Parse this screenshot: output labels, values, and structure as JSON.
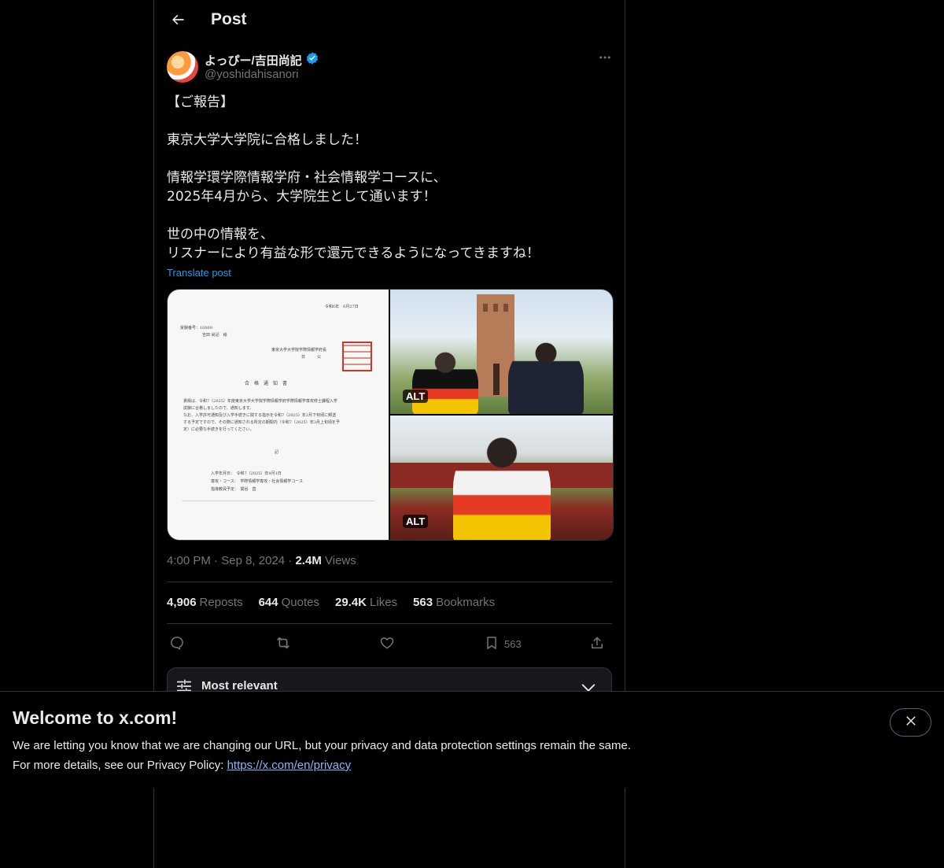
{
  "header": {
    "title": "Post"
  },
  "post": {
    "author_name": "よっぴー/吉田尚記",
    "author_handle": "@yoshidahisanori",
    "text": "【ご報告】\n\n東京大学大学院に合格しました！\n\n情報学環学際情報学府・社会情報学コースに、\n2025年4月から、大学院生として通います！\n\n世の中の情報を、\nリスナーにより有益な形で還元できるようになってきますね！",
    "translate_label": "Translate post",
    "media": {
      "alt_badge_1": "ALT",
      "alt_badge_2": "ALT",
      "document": {
        "date": "令和6年　6月27日",
        "exam_no": "受験番号：10000",
        "recipient": "吉田 尚記　様",
        "sender_1": "東京大学大学院学際情報学府長",
        "sender_2": "日　　　公",
        "heading": "合　格　通　知　書",
        "body_1": "貴殿は、令和7（2025）年度東京大学大学院学際情報学府学際情報学専攻修士課程入学",
        "body_2": "試験に合格しましたので、通知します。",
        "body_3": "なお、入学許可通知及び入学手続きに関する指示を令和7（2025）年2月下旬頃に郵送",
        "body_4": "する予定ですので、その際に通知される所定の期間内（令和7（2025）年3月上旬頃を予",
        "body_5": "定）に必要な手続きを行ってください。",
        "note": "記",
        "enroll": "入学年月日：　令和7（2025）年4月1日",
        "course": "専攻・コース：　学際情報学専攻・社会情報学コース",
        "advisor": "指導教員予定：　関谷　直"
      }
    },
    "time": "4:00 PM",
    "date": "Sep 8, 2024",
    "views_count": "2.4M",
    "views_label": "Views",
    "stats": {
      "reposts_count": "4,906",
      "reposts_label": "Reposts",
      "quotes_count": "644",
      "quotes_label": "Quotes",
      "likes_count": "29.4K",
      "likes_label": "Likes",
      "bookmarks_count": "563",
      "bookmarks_label": "Bookmarks"
    },
    "actions": {
      "bookmark_count": "563"
    }
  },
  "replies": {
    "sort_label": "Most relevant"
  },
  "banner": {
    "title": "Welcome to x.com!",
    "line1": "We are letting you know that we are changing our URL, but your privacy and data protection settings remain the same.",
    "line2_prefix": "For more details, see our Privacy Policy: ",
    "link_text": "https://x.com/en/privacy"
  },
  "icons": {
    "back": "back-arrow-icon",
    "verified": "verified-badge-icon",
    "more": "more-icon",
    "reply": "reply-icon",
    "repost": "repost-icon",
    "like": "heart-icon",
    "bookmark": "bookmark-icon",
    "share": "share-icon",
    "sort": "sliders-icon",
    "chevron": "chevron-down-icon",
    "close": "close-icon"
  },
  "colors": {
    "accent": "#1d9bf0",
    "background": "#000000",
    "muted": "#71767b"
  }
}
